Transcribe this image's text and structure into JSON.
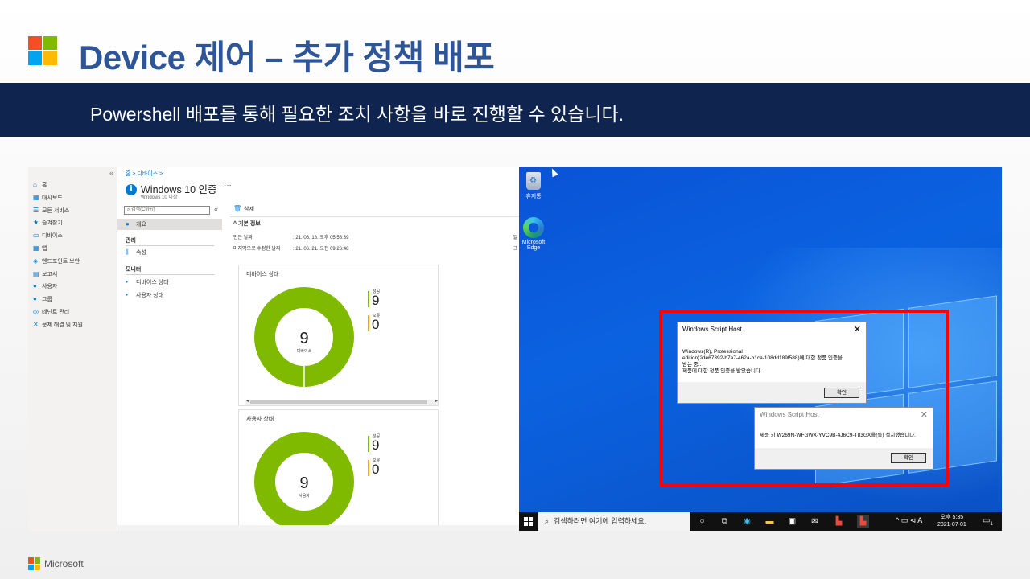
{
  "slide": {
    "title": "Device 제어 – 추가 정책 배포",
    "banner": "Powershell 배포를 통해 필요한 조치 사항을 바로 진행할 수 있습니다.",
    "footer": "Microsoft",
    "colors": {
      "logo_red": "#f25022",
      "logo_green": "#7fba00",
      "logo_blue": "#00a4ef",
      "logo_yellow": "#ffb900",
      "title": "#2e5597",
      "banner": "#0f2550",
      "donut": "#7fba00",
      "highlight": "#ff0000"
    }
  },
  "portal": {
    "nav_collapse": "«",
    "nav": [
      {
        "label": "홈",
        "icon": "home-icon",
        "glyph": "⌂"
      },
      {
        "label": "대시보드",
        "icon": "dashboard-icon",
        "glyph": "▦"
      },
      {
        "label": "모든 서비스",
        "icon": "services-icon",
        "glyph": "☰"
      },
      {
        "label": "즐겨찾기",
        "icon": "star-icon",
        "glyph": "★"
      },
      {
        "label": "디바이스",
        "icon": "devices-icon",
        "glyph": "▭"
      },
      {
        "label": "앱",
        "icon": "apps-icon",
        "glyph": "▦"
      },
      {
        "label": "엔드포인트 보안",
        "icon": "shield-icon",
        "glyph": "◈"
      },
      {
        "label": "보고서",
        "icon": "reports-icon",
        "glyph": "▤"
      },
      {
        "label": "사용자",
        "icon": "user-icon",
        "glyph": "●"
      },
      {
        "label": "그룹",
        "icon": "group-icon",
        "glyph": "●"
      },
      {
        "label": "테넌트 관리",
        "icon": "tenant-icon",
        "glyph": "◎"
      },
      {
        "label": "문제 해결 및 지원",
        "icon": "wrench-icon",
        "glyph": "✕"
      }
    ],
    "breadcrumb": "홈 > 디바이스 >",
    "page_title": "Windows 10 인증",
    "page_more": "···",
    "page_subtitle": "Windows 10 이상",
    "search_placeholder": "검색(Ctrl+/)",
    "search_collapse": "«",
    "overview": "개요",
    "section_manage": "관리",
    "properties": "속성",
    "section_monitor": "모니터",
    "device_status": "디바이스 상태",
    "user_status": "사용자 상태",
    "delete": "삭제",
    "essentials": "기본 정보",
    "created_label": "만든 날짜",
    "created_value": ": 21. 06. 18. 오후 05:58:39",
    "modified_label": "마지막으로 수정한 날짜",
    "modified_value": ": 21. 06. 21. 오전 09:26:48",
    "edge_label_1": "일",
    "edge_label_2": "그",
    "cards": [
      {
        "title": "디바이스 상태",
        "total": "9",
        "center_label": "디바이스",
        "success_label": "성공",
        "success": "9",
        "error_label": "오류",
        "error": "0",
        "success_fraction": 1.0
      },
      {
        "title": "사용자 상태",
        "total": "9",
        "center_label": "사용자",
        "success_label": "성공",
        "success": "9",
        "error_label": "오류",
        "error": "0",
        "success_fraction": 1.0
      }
    ]
  },
  "desktop": {
    "recycle_bin": "휴지통",
    "edge_label": "Microsoft Edge",
    "dialog1": {
      "title": "Windows Script Host",
      "line1": "Windows(R), Professional",
      "line2": "edition(2de67392-b7a7-462a-b1ca-108dd189f588)에 대한 정품 인증을",
      "line3": "받는 중...",
      "line4": "제품에 대한 정품 인증을 받았습니다.",
      "ok": "확인"
    },
    "dialog2": {
      "title": "Windows Script Host",
      "message": "제품 키 W269N-WFGWX-YVC9B-4J6C9-T83GX을(를) 설치했습니다.",
      "ok": "확인"
    },
    "taskbar": {
      "search": "검색하려면 여기에 입력하세요.",
      "tray": "^ ▭ ⊲ A",
      "time": "오후 5:35",
      "date": "2021-07-01",
      "notif_count": "1"
    }
  }
}
